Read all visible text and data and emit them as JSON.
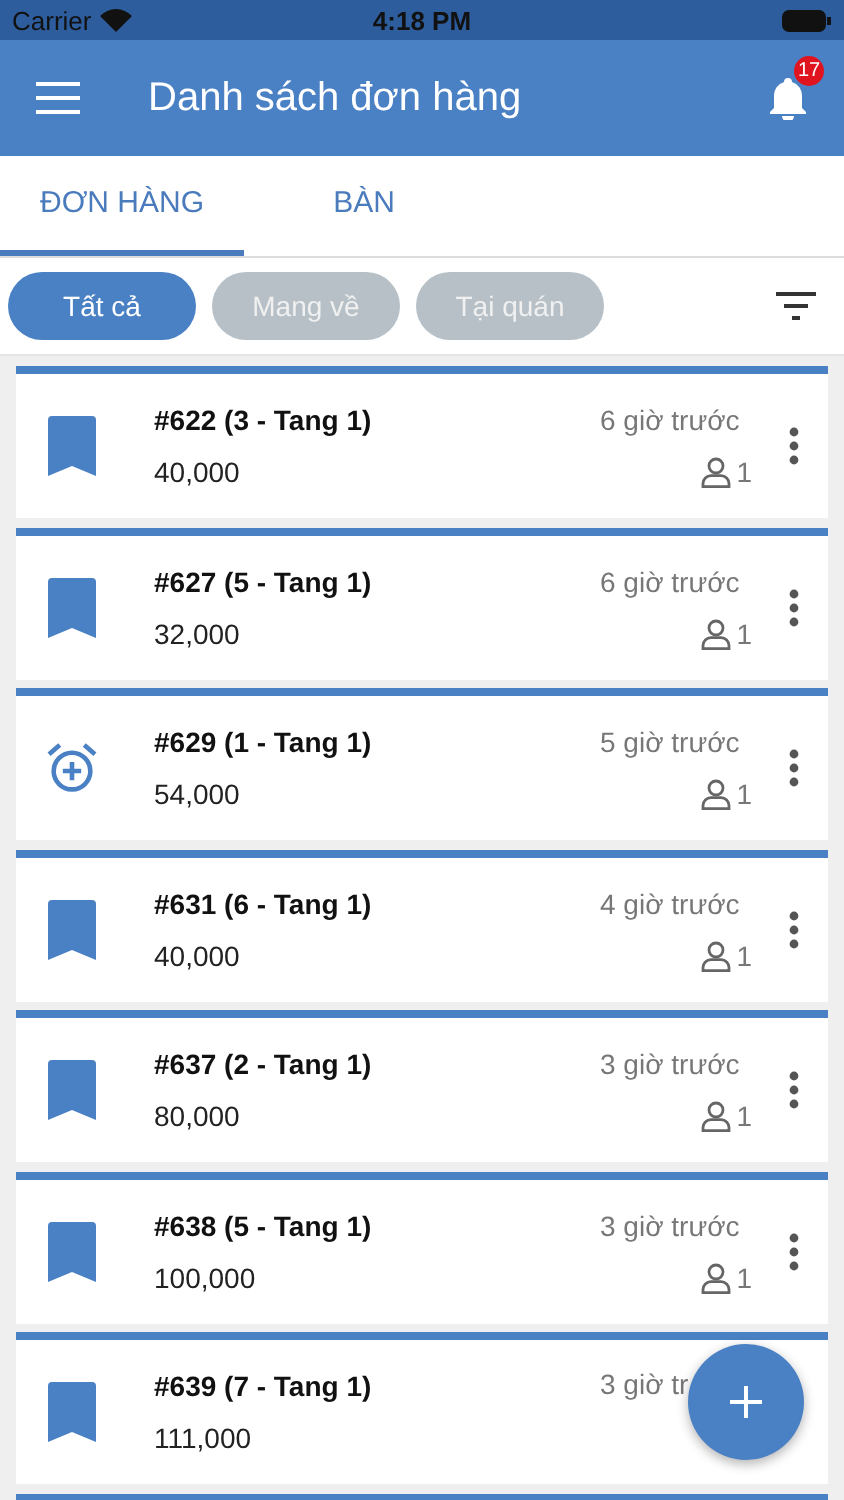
{
  "status_bar": {
    "carrier": "Carrier",
    "time": "4:18 PM"
  },
  "header": {
    "title": "Danh sách đơn hàng",
    "notification_count": "17"
  },
  "tabs": [
    {
      "label": "ĐƠN HÀNG",
      "selected": true
    },
    {
      "label": "BÀN",
      "selected": false
    }
  ],
  "filters": [
    {
      "label": "Tất cả",
      "selected": true
    },
    {
      "label": "Mang về",
      "selected": false
    },
    {
      "label": "Tại quán",
      "selected": false
    }
  ],
  "orders": [
    {
      "kind": "bookmark",
      "title": "#622 (3 - Tang 1)",
      "amount": "40,000",
      "time": "6 giờ trước",
      "guests": "1"
    },
    {
      "kind": "bookmark",
      "title": "#627 (5 - Tang 1)",
      "amount": "32,000",
      "time": "6 giờ trước",
      "guests": "1"
    },
    {
      "kind": "alarm",
      "title": "#629 (1 - Tang 1)",
      "amount": "54,000",
      "time": "5 giờ trước",
      "guests": "1"
    },
    {
      "kind": "bookmark",
      "title": "#631 (6 - Tang 1)",
      "amount": "40,000",
      "time": "4 giờ trước",
      "guests": "1"
    },
    {
      "kind": "bookmark",
      "title": "#637 (2 - Tang 1)",
      "amount": "80,000",
      "time": "3 giờ trước",
      "guests": "1"
    },
    {
      "kind": "bookmark",
      "title": "#638 (5 - Tang 1)",
      "amount": "100,000",
      "time": "3 giờ trước",
      "guests": "1"
    },
    {
      "kind": "bookmark",
      "title": "#639 (7 - Tang 1)",
      "amount": "111,000",
      "time": "3 giờ tr"
    }
  ]
}
